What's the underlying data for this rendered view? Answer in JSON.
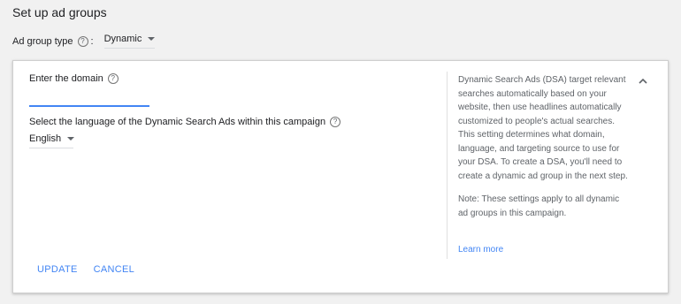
{
  "page_title": "Set up ad groups",
  "ad_group_type": {
    "label": "Ad group type",
    "colon": ":",
    "value": "Dynamic"
  },
  "card": {
    "domain_label": "Enter the domain",
    "domain_value": "",
    "language_label": "Select the language of the Dynamic Search Ads within this campaign",
    "language_value": "English",
    "update_label": "UPDATE",
    "cancel_label": "CANCEL",
    "info_paragraph_1": "Dynamic Search Ads (DSA) target relevant searches automatically based on your website, then use headlines automatically customized to people's actual searches. This setting determines what domain, language, and targeting source to use for your DSA. To create a DSA, you'll need to create a dynamic ad group in the next step.",
    "info_paragraph_2": "Note: These settings apply to all dynamic ad groups in this campaign.",
    "learn_more": "Learn more"
  },
  "icons": {
    "help": "?",
    "help_icon_name": "help-circle-icon",
    "caret_icon_name": "dropdown-caret-icon",
    "collapse_icon_name": "chevron-up-icon"
  },
  "colors": {
    "accent": "#4285f4",
    "background": "#f1f1f1",
    "card": "#ffffff"
  }
}
